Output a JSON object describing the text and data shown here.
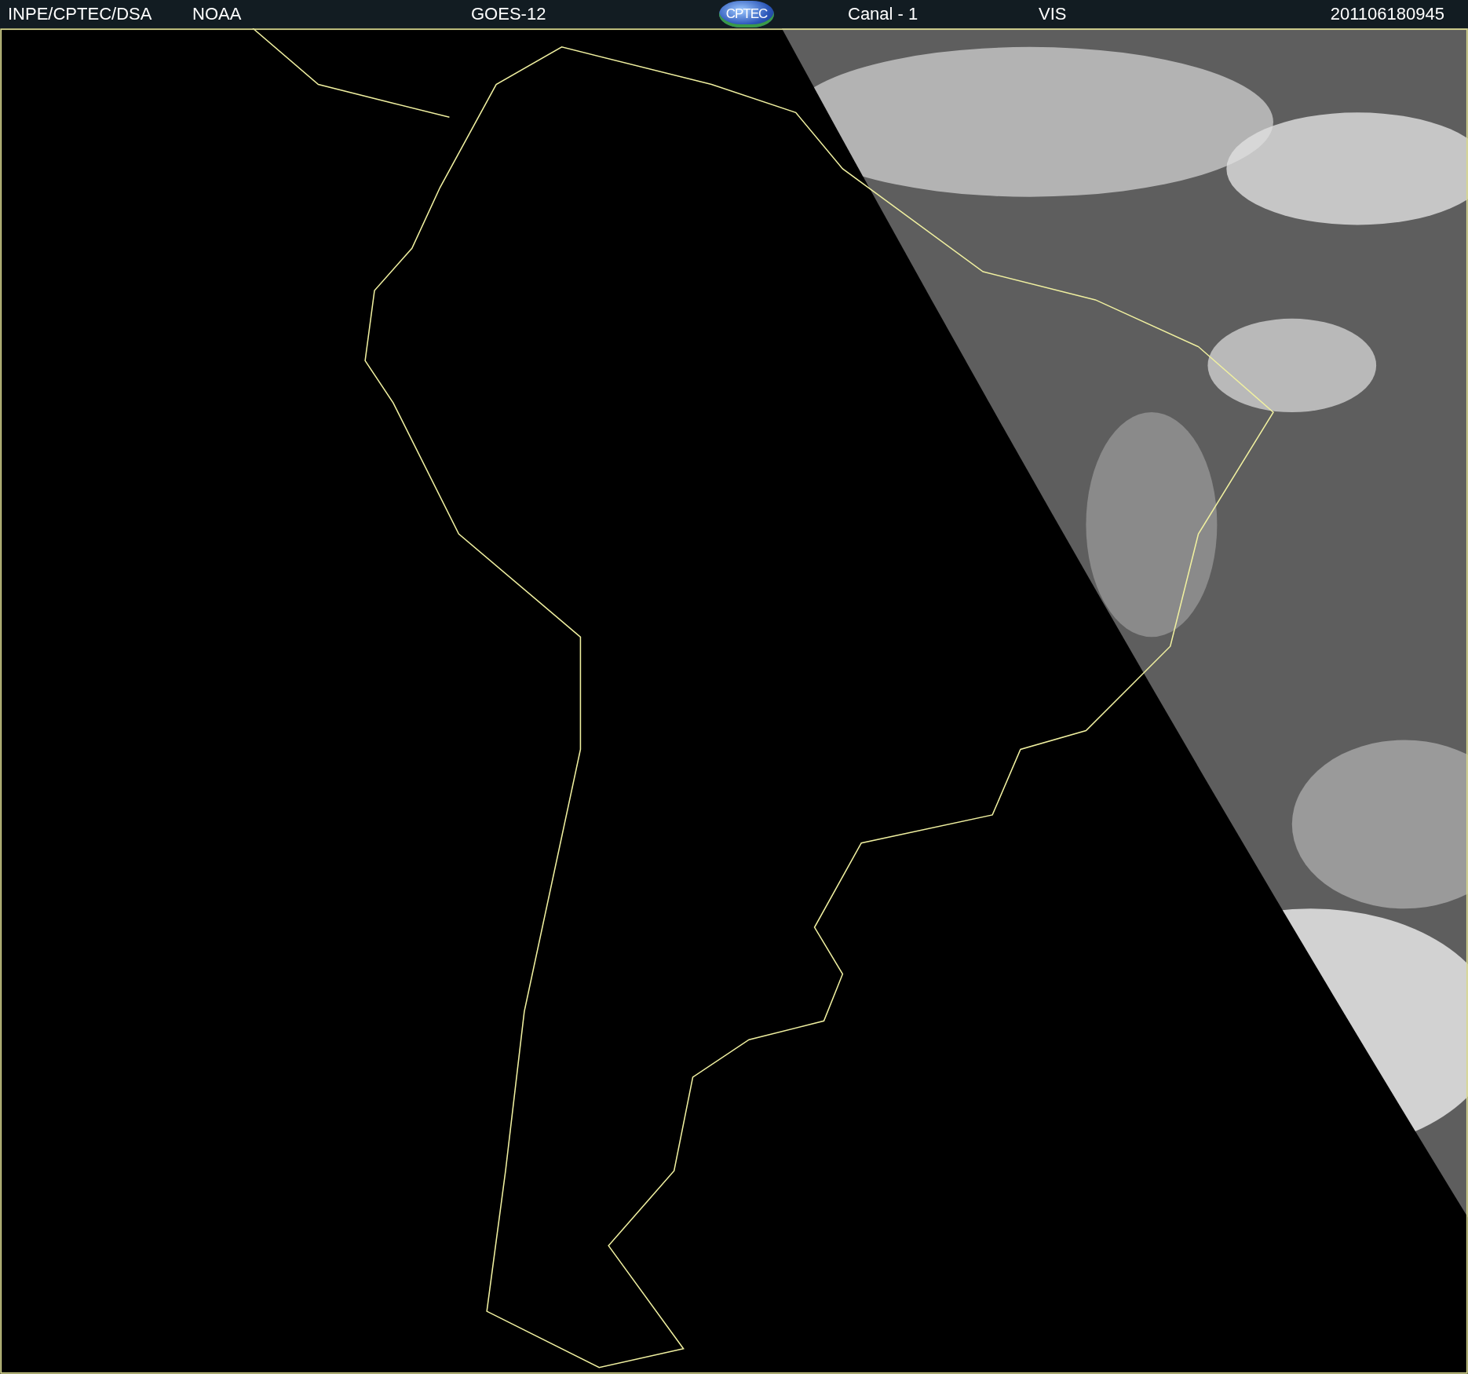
{
  "header": {
    "items": [
      {
        "kind": "text",
        "text": "INPE/CPTEC/DSA"
      },
      {
        "kind": "text",
        "text": "NOAA"
      },
      {
        "kind": "text",
        "text": "GOES-12"
      },
      {
        "kind": "logo",
        "text": "CPTEC"
      },
      {
        "kind": "text",
        "text": "Canal - 1"
      },
      {
        "kind": "text",
        "text": "VIS"
      },
      {
        "kind": "text",
        "text": "201106180945"
      }
    ]
  }
}
